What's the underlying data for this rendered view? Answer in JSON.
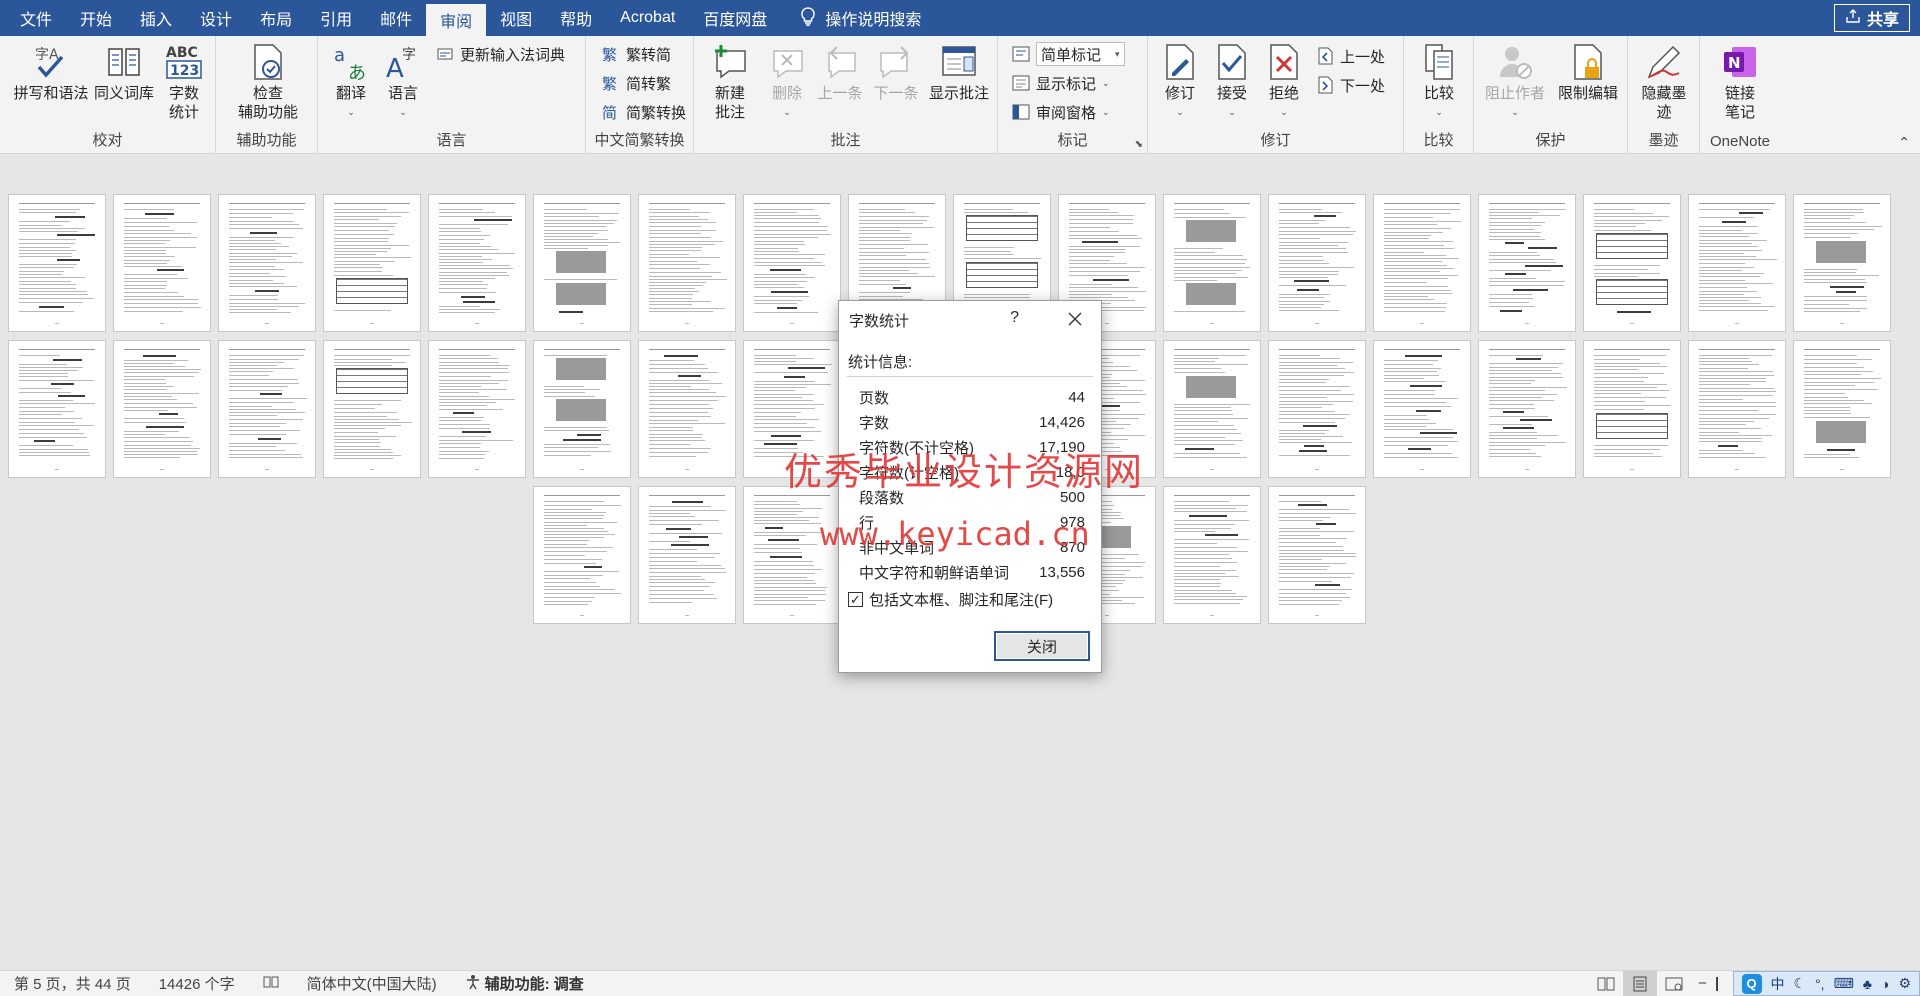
{
  "menubar": {
    "tabs": [
      "文件",
      "开始",
      "插入",
      "设计",
      "布局",
      "引用",
      "邮件",
      "审阅",
      "视图",
      "帮助",
      "Acrobat",
      "百度网盘"
    ],
    "active_tab": "审阅",
    "tell_me": "操作说明搜索",
    "share": "共享"
  },
  "ribbon": {
    "proofing": {
      "label": "校对",
      "spelling": "拼写和语法",
      "thesaurus": "同义词库",
      "wordcount": "字数\n统计"
    },
    "accessibility": {
      "label": "辅助功能",
      "check": "检查\n辅助功能"
    },
    "language": {
      "label": "语言",
      "translate": "翻译",
      "language": "语言",
      "update_ime": "更新输入法词典"
    },
    "chinese_conv": {
      "label": "中文简繁转换",
      "to_simplified": "繁转简",
      "to_traditional": "简转繁",
      "convert": "简繁转换"
    },
    "comments": {
      "label": "批注",
      "new": "新建\n批注",
      "delete": "删除",
      "prev": "上一条",
      "next": "下一条",
      "show": "显示批注"
    },
    "tracking": {
      "label": "标记",
      "markup_mode": "简单标记",
      "show_markup": "显示标记",
      "review_pane": "审阅窗格"
    },
    "changes": {
      "label": "修订",
      "track": "修订",
      "accept": "接受",
      "reject": "拒绝",
      "prev": "上一处",
      "next": "下一处"
    },
    "compare": {
      "label": "比较",
      "compare": "比较"
    },
    "protect": {
      "label": "保护",
      "block_authors": "阻止作者",
      "restrict": "限制编辑"
    },
    "ink": {
      "label": "墨迹",
      "hide_ink": "隐藏墨\n迹"
    },
    "onenote": {
      "label": "OneNote",
      "linked_notes": "链接\n笔记"
    }
  },
  "dialog": {
    "title": "字数统计",
    "help": "?",
    "stats_label": "统计信息:",
    "rows": [
      {
        "label": "页数",
        "value": "44"
      },
      {
        "label": "字数",
        "value": "14,426"
      },
      {
        "label": "字符数(不计空格)",
        "value": "17,190"
      },
      {
        "label": "字符数(计空格)",
        "value": "18,0"
      },
      {
        "label": "段落数",
        "value": "500"
      },
      {
        "label": "行",
        "value": "978"
      },
      {
        "label": "非中文单词",
        "value": "870"
      },
      {
        "label": "中文字符和朝鲜语单词",
        "value": "13,556"
      }
    ],
    "include_label": "包括文本框、脚注和尾注(F)",
    "include_checked": true,
    "close_button": "关闭"
  },
  "watermark": {
    "line1": "优秀毕业设计资源网",
    "line2": "www.keyicad.cn"
  },
  "statusbar": {
    "page_info": "第 5 页，共 44 页",
    "word_count": "14426 个字",
    "language": "简体中文(中国大陆)",
    "accessibility": "辅助功能: 调查",
    "ime_mode": "中"
  },
  "colors": {
    "accent": "#2b579a",
    "watermark": "#e23a3a",
    "ribbon_bg": "#f3f3f3",
    "doc_bg": "#e6e6e6"
  }
}
